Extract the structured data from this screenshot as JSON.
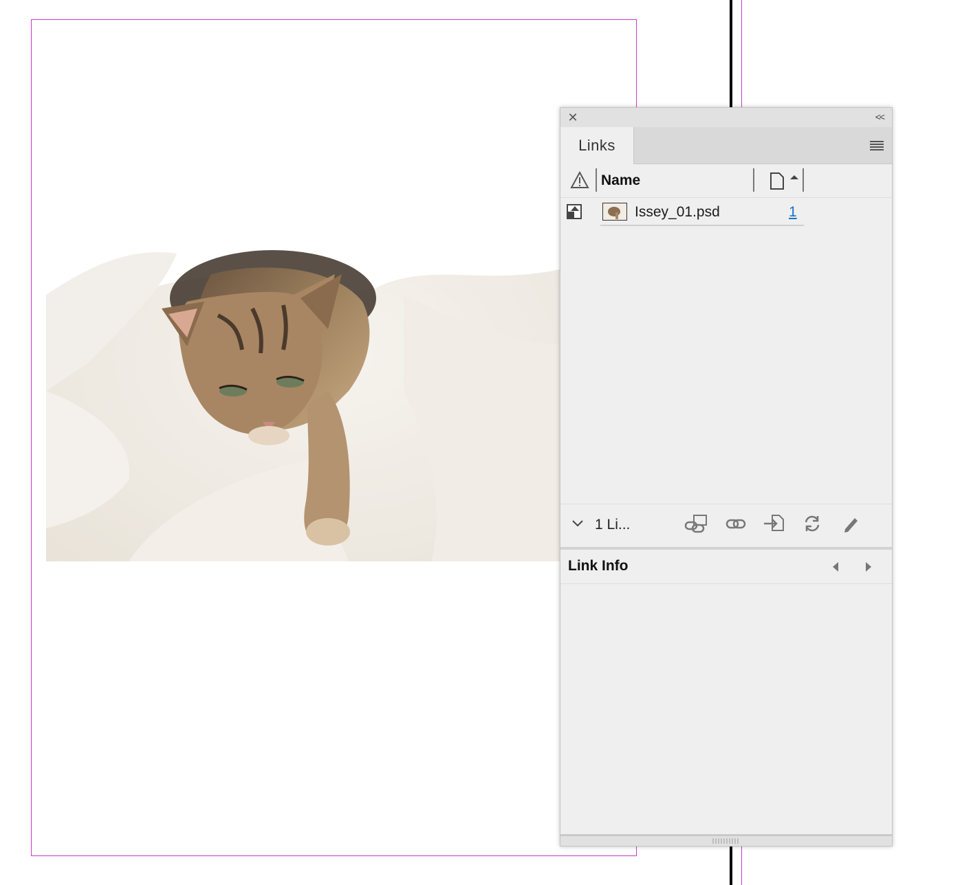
{
  "document": {
    "image_alt": "tabby cat lying on white bedding"
  },
  "panel": {
    "tab_label": "Links",
    "columns": {
      "name": "Name"
    },
    "links": [
      {
        "name": "Issey_01.psd",
        "page": "1"
      }
    ],
    "toolbar": {
      "count_label": "1 Li..."
    },
    "info": {
      "title": "Link Info"
    }
  },
  "colors": {
    "margin_guide": "#c33bc9",
    "page_link": "#1672c4",
    "panel_bg": "#efefef"
  }
}
